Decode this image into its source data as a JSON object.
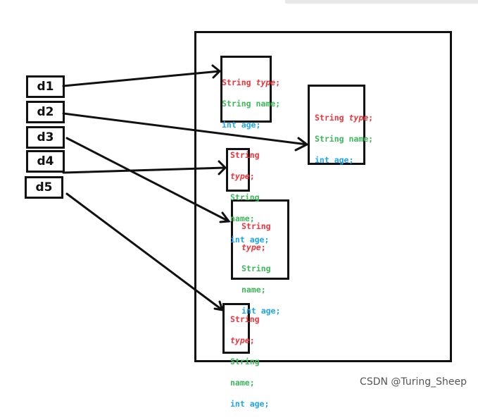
{
  "refs": [
    "d1",
    "d2",
    "d3",
    "d4",
    "d5"
  ],
  "fields": {
    "type_kw": "String ",
    "type_name": "type",
    "semi": ";",
    "name_line": "String name;",
    "name_kw": "String",
    "name_name": "name;",
    "age_line": "int age;"
  },
  "colors": {
    "type": "#f0343c",
    "name": "#3cb95a",
    "age": "#1ea6ef"
  },
  "watermark": "CSDN @Turing_Sheep"
}
